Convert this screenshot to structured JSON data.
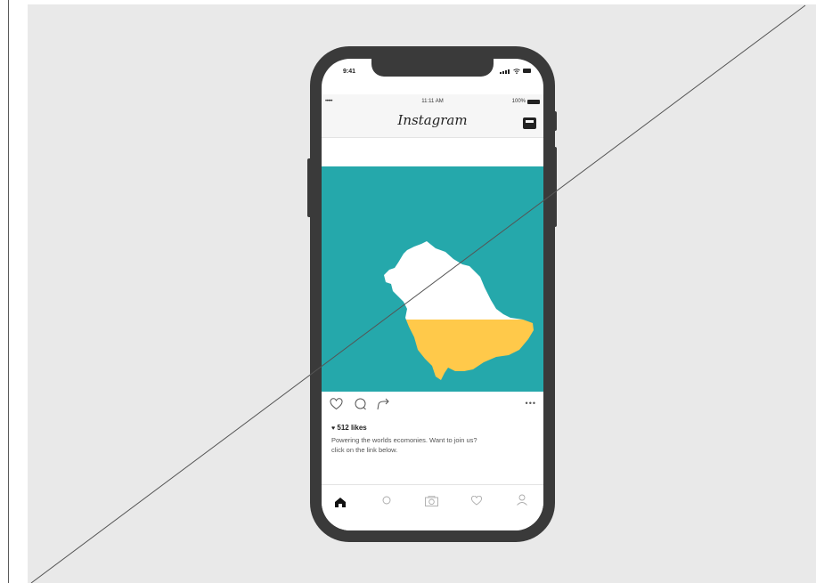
{
  "device": {
    "status_time": "9:41"
  },
  "instagram": {
    "carrier": "•••••",
    "clock": "11:11 AM",
    "battery": "100%",
    "logo": "Instagram"
  },
  "post": {
    "likes": "512 likes",
    "caption_line1": "Powering the worlds ecomonies. Want to join us?",
    "caption_line2": "click on the link below.",
    "image_colors": {
      "background": "#25a8ab",
      "upper": "#ffffff",
      "lower": "#ffc94a"
    }
  },
  "actions": {
    "icons": [
      "heart-icon",
      "comment-icon",
      "share-icon"
    ],
    "more": "•••"
  },
  "tabbar": {
    "tabs": [
      "home-icon",
      "search-icon",
      "camera-icon",
      "heart-icon",
      "profile-icon"
    ],
    "active": "home-icon"
  }
}
